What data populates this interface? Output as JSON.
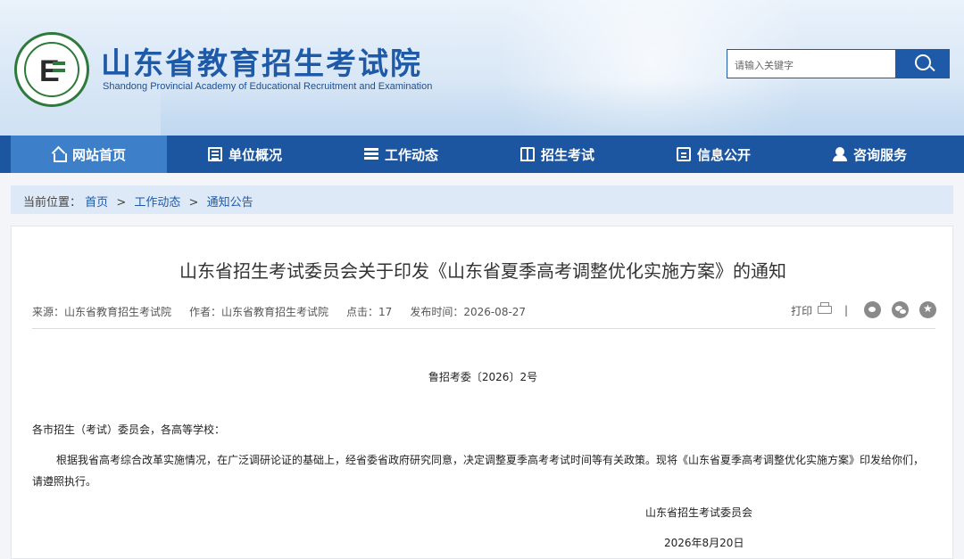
{
  "header": {
    "title": "山东省教育招生考试院",
    "subtitle": "Shandong Provincial Academy of Educational Recruitment and Examination",
    "logo_letter": "E"
  },
  "search": {
    "placeholder": "请输入关键字",
    "icon": "search-icon"
  },
  "nav": {
    "items": [
      {
        "label": "网站首页",
        "icon": "home-icon",
        "active": true
      },
      {
        "label": "单位概况",
        "icon": "building-icon"
      },
      {
        "label": "工作动态",
        "icon": "list-icon"
      },
      {
        "label": "招生考试",
        "icon": "book-icon"
      },
      {
        "label": "信息公开",
        "icon": "info-icon"
      },
      {
        "label": "咨询服务",
        "icon": "service-icon"
      }
    ]
  },
  "breadcrumb": {
    "prefix": "当前位置：",
    "items": [
      "首页",
      "工作动态",
      "通知公告"
    ],
    "separator": ">"
  },
  "article": {
    "title": "山东省招生考试委员会关于印发《山东省夏季高考调整优化实施方案》的通知",
    "meta": {
      "source": "来源：山东省教育招生考试院",
      "author": "作者：山东省教育招生考试院",
      "clicks": "点击：17",
      "published": "发布时间：2026-08-27"
    },
    "print_label": "打印",
    "doc_number": "鲁招考委〔2026〕2号",
    "salutation": "各市招生（考试）委员会，各高等学校：",
    "body_line1": "根据我省高考综合改革实施情况，在广泛调研论证的基础上，经省委省政府研究同意，决定调整夏季高考考试时间等有关政策。现将《山东省夏季高考调整优化实施方案》印发给你们，",
    "body_line2": "请遵照执行。",
    "signature": "山东省招生考试委员会",
    "date": "2026年8月20日"
  },
  "colors": {
    "brand_blue": "#1e5aa8",
    "nav_bg": "#1d56a0",
    "nav_active": "#3e7fc9",
    "crumb_bg": "#dde9f6"
  }
}
